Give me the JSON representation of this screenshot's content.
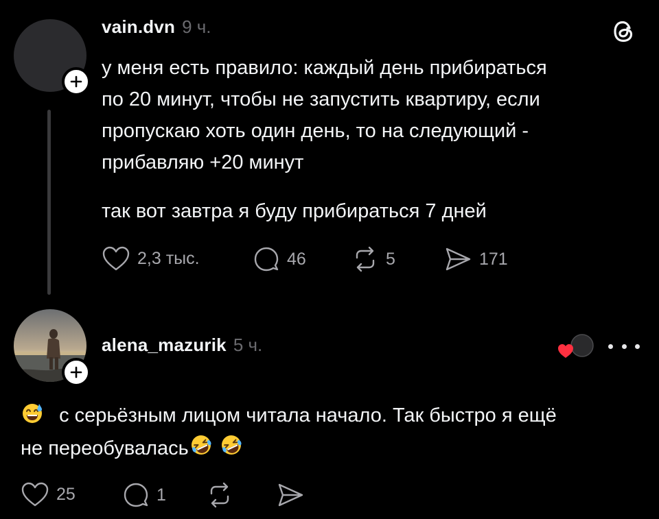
{
  "post": {
    "username": "vain.dvn",
    "time": "9 ч.",
    "paragraph1_lines": [
      "у меня есть правило: каждый день прибираться",
      "по 20 минут, чтобы не запустить квартиру, если",
      "пропускаю хоть один день, то на следующий -",
      "прибавляю +20 минут"
    ],
    "paragraph2": "так вот завтра я буду прибираться 7 дней",
    "actions": {
      "likes": "2,3 тыс.",
      "replies": "46",
      "reposts": "5",
      "shares": "171"
    }
  },
  "reply": {
    "username": "alena_mazurik",
    "time": "5 ч.",
    "line1": "с серьёзным лицом читала начало. Так быстро я ещё",
    "line2": "не переобувалась",
    "leading_emoji": "smiling-face-with-sweat",
    "trailing_emoji": "rolling-on-the-floor-laughing",
    "actions": {
      "likes": "25",
      "replies": "1"
    }
  },
  "icons": {
    "app_logo": "threads-logo-icon",
    "like": "heart-icon",
    "reply": "speech-bubble-icon",
    "repost": "repost-icon",
    "share": "send-icon",
    "follow": "plus-icon",
    "more": "more-dots-icon"
  },
  "colors": {
    "background": "#000000",
    "text": "#f3f5f7",
    "muted": "#6a6a6e",
    "action_text": "#a8a8ad",
    "thread_line": "#3a3a3c",
    "liked_heart": "#ff3040"
  }
}
